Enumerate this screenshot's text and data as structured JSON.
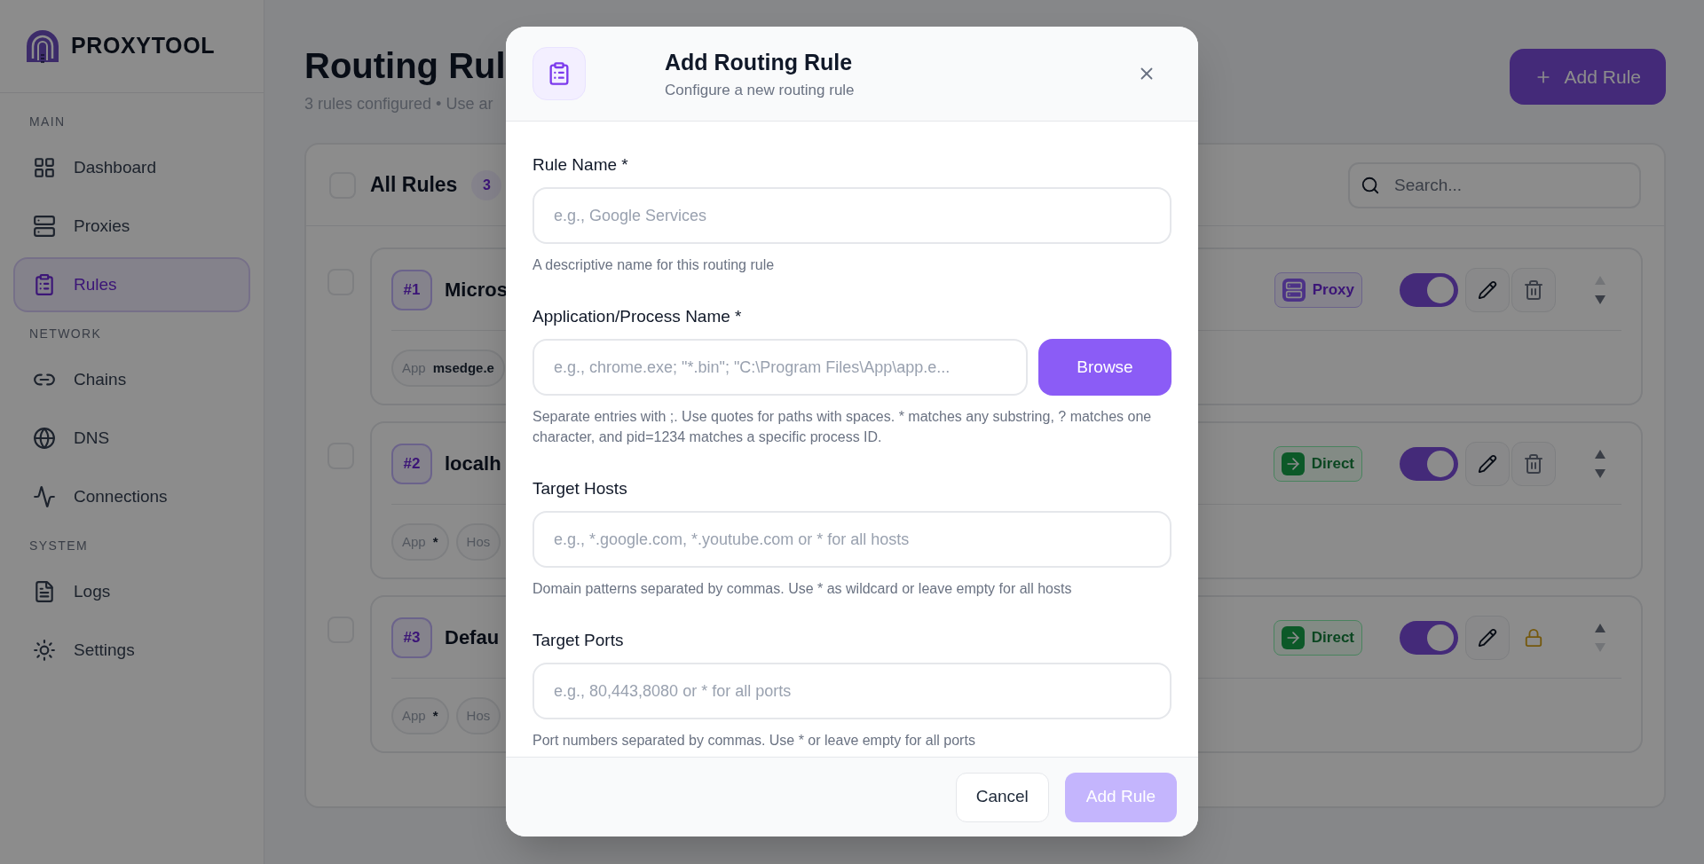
{
  "sidebar": {
    "logo": "PROXYTOOL",
    "sections": [
      {
        "title": "MAIN",
        "items": [
          {
            "label": "Dashboard",
            "selected": false
          },
          {
            "label": "Proxies",
            "selected": false
          },
          {
            "label": "Rules",
            "selected": true
          }
        ]
      },
      {
        "title": "NETWORK",
        "items": [
          {
            "label": "Chains",
            "selected": false
          },
          {
            "label": "DNS",
            "selected": false
          },
          {
            "label": "Connections",
            "selected": false
          }
        ]
      },
      {
        "title": "SYSTEM",
        "items": [
          {
            "label": "Logs",
            "selected": false
          },
          {
            "label": "Settings",
            "selected": false
          }
        ]
      }
    ]
  },
  "page": {
    "title": "Routing Rul",
    "subtitle": "3 rules configured • Use ar",
    "add_button": "Add Rule"
  },
  "panel": {
    "title": "All Rules",
    "count": "3",
    "select_all_checked": false,
    "search": {
      "placeholder": "Search..."
    }
  },
  "rules": [
    {
      "number": "#1",
      "name": "Micros",
      "checked": false,
      "mode": {
        "kind": "proxy",
        "label": "Proxy"
      },
      "enabled": true,
      "locked": false,
      "up_disabled": true,
      "down_disabled": false,
      "chips": [
        {
          "label": "App",
          "value": "msedge.e"
        }
      ]
    },
    {
      "number": "#2",
      "name": "localh",
      "checked": false,
      "mode": {
        "kind": "direct",
        "label": "Direct"
      },
      "enabled": true,
      "locked": false,
      "up_disabled": false,
      "down_disabled": false,
      "chips": [
        {
          "label": "App",
          "value": "*"
        },
        {
          "label": "Hos"
        }
      ]
    },
    {
      "number": "#3",
      "name": "Defau",
      "checked": false,
      "mode": {
        "kind": "direct",
        "label": "Direct"
      },
      "enabled": true,
      "locked": true,
      "up_disabled": false,
      "down_disabled": true,
      "chips": [
        {
          "label": "App",
          "value": "*"
        },
        {
          "label": "Hos"
        }
      ]
    }
  ],
  "modal": {
    "title": "Add Routing Rule",
    "subtitle": "Configure a new routing rule",
    "fields": [
      {
        "label": "Rule Name *",
        "placeholder": "e.g., Google Services",
        "help": "A descriptive name for this routing rule"
      },
      {
        "label": "Application/Process Name *",
        "placeholder": "e.g., chrome.exe; \"*.bin\"; \"C:\\Program Files\\App\\app.e...",
        "help": "Separate entries with ;. Use quotes for paths with spaces. * matches any substring, ? matches one character, and pid=1234 matches a specific process ID.",
        "button": "Browse"
      },
      {
        "label": "Target Hosts",
        "placeholder": "e.g., *.google.com, *.youtube.com or * for all hosts",
        "help": "Domain patterns separated by commas. Use * as wildcard or leave empty for all hosts"
      },
      {
        "label": "Target Ports",
        "placeholder": "e.g., 80,443,8080 or * for all ports",
        "help": "Port numbers separated by commas. Use * or leave empty for all ports"
      }
    ],
    "cancel": "Cancel",
    "submit": {
      "label": "Add Rule",
      "disabled": true
    }
  }
}
